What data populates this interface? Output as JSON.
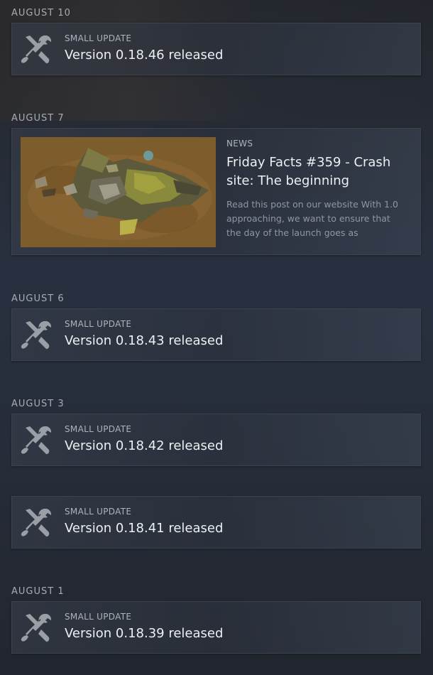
{
  "feed": [
    {
      "date": "AUGUST 10",
      "kind": "SMALL UPDATE",
      "title": "Version 0.18.46 released",
      "icon": "wrench-screwdriver-icon"
    },
    {
      "date": "AUGUST 7",
      "kind": "NEWS",
      "title": "Friday Facts #359 - Crash site: The beginning",
      "summary": "Read this post on our website With 1.0 approaching, we want to ensure that the day of the launch goes as smoothl...",
      "thumbnail": "crashed-spaceship-image"
    },
    {
      "date": "AUGUST 6",
      "kind": "SMALL UPDATE",
      "title": "Version 0.18.43 released",
      "icon": "wrench-screwdriver-icon"
    },
    {
      "date": "AUGUST 3",
      "kind": "SMALL UPDATE",
      "title": "Version 0.18.42 released",
      "icon": "wrench-screwdriver-icon"
    },
    {
      "date": "",
      "kind": "SMALL UPDATE",
      "title": "Version 0.18.41 released",
      "icon": "wrench-screwdriver-icon"
    },
    {
      "date": "AUGUST 1",
      "kind": "SMALL UPDATE",
      "title": "Version 0.18.39 released",
      "icon": "wrench-screwdriver-icon"
    }
  ],
  "colors": {
    "text_primary": "#ecf0f3",
    "text_secondary": "#aeb4bc",
    "date_label": "#a7adb5",
    "summary": "#8f97a2",
    "icon": "#9a9fa6"
  }
}
